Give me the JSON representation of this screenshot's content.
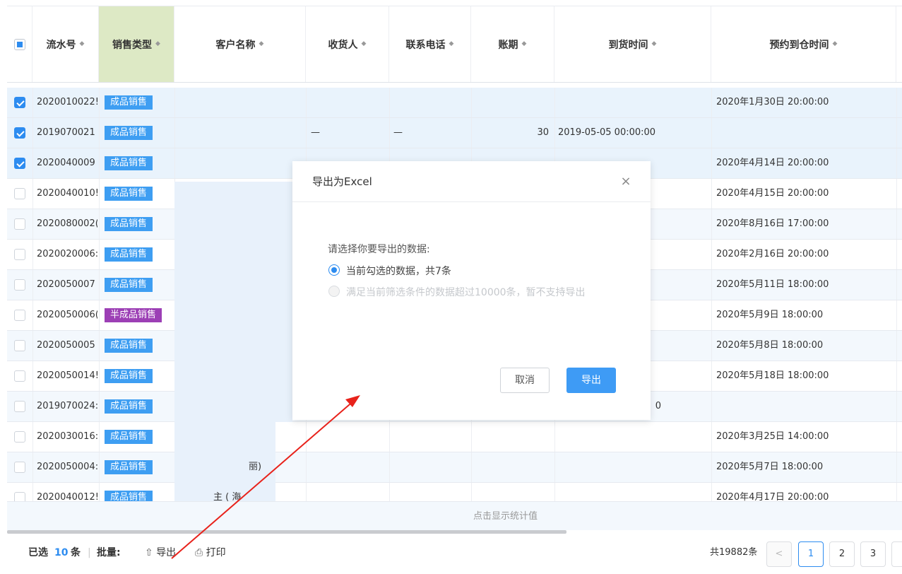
{
  "colors": {
    "tag_finished": "#3e9ef2",
    "tag_semi": "#9c3fb5",
    "primary": "#2d8cf0",
    "arrow": "#e8221b"
  },
  "table": {
    "columns": [
      "流水号",
      "销售类型",
      "客户名称",
      "收货人",
      "联系电话",
      "账期",
      "到货时间",
      "预约到仓时间"
    ],
    "rows": [
      {
        "checked": true,
        "serial": "2020010022!",
        "type": "成品销售",
        "type_kind": "finished",
        "receiver": "",
        "phone": "",
        "term": "",
        "arrival": "",
        "appointment": "2020年1月30日 20:00:00"
      },
      {
        "checked": true,
        "serial": "2019070021",
        "type": "成品销售",
        "type_kind": "finished",
        "receiver": "—",
        "phone": "—",
        "term": "30",
        "arrival": "2019-05-05 00:00:00",
        "appointment": ""
      },
      {
        "checked": true,
        "serial": "2020040009",
        "type": "成品销售",
        "type_kind": "finished",
        "receiver": "",
        "phone": "",
        "term": "",
        "arrival": "",
        "appointment": "2020年4月14日 20:00:00"
      },
      {
        "checked": false,
        "serial": "2020040010!",
        "type": "成品销售",
        "type_kind": "finished",
        "receiver": "",
        "phone": "",
        "term": "",
        "arrival": "",
        "appointment": "2020年4月15日 20:00:00"
      },
      {
        "checked": false,
        "serial": "2020080002(",
        "type": "成品销售",
        "type_kind": "finished",
        "receiver": "",
        "phone": "",
        "term": "",
        "arrival": "",
        "appointment": "2020年8月16日 17:00:00"
      },
      {
        "checked": false,
        "serial": "2020020006:",
        "type": "成品销售",
        "type_kind": "finished",
        "receiver": "",
        "phone": "",
        "term": "",
        "arrival": "",
        "appointment": "2020年2月16日 20:00:00"
      },
      {
        "checked": false,
        "serial": "2020050007",
        "type": "成品销售",
        "type_kind": "finished",
        "receiver": "",
        "phone": "",
        "term": "",
        "arrival": "",
        "appointment": "2020年5月11日 18:00:00"
      },
      {
        "checked": false,
        "serial": "2020050006(",
        "type": "半成品销售",
        "type_kind": "semi",
        "receiver": "",
        "phone": "",
        "term": "",
        "arrival": "",
        "appointment": "2020年5月9日 18:00:00"
      },
      {
        "checked": false,
        "serial": "2020050005",
        "type": "成品销售",
        "type_kind": "finished",
        "receiver": "",
        "phone": "",
        "term": "",
        "arrival": "",
        "appointment": "2020年5月8日 18:00:00"
      },
      {
        "checked": false,
        "serial": "2020050014!",
        "type": "成品销售",
        "type_kind": "finished",
        "receiver": "",
        "phone": "",
        "term": "",
        "arrival": "",
        "appointment": "2020年5月18日 18:00:00"
      },
      {
        "checked": false,
        "serial": "2019070024:",
        "type": "成品销售",
        "type_kind": "finished",
        "receiver": "",
        "phone": "",
        "term": "",
        "arrival": "0",
        "appointment": ""
      },
      {
        "checked": false,
        "serial": "2020030016:",
        "type": "成品销售",
        "type_kind": "finished",
        "receiver": "",
        "phone": "",
        "term": "",
        "arrival": "",
        "appointment": "2020年3月25日 14:00:00"
      },
      {
        "checked": false,
        "serial": "2020050004:",
        "type": "成品销售",
        "type_kind": "finished",
        "receiver": "",
        "phone": "",
        "term": "",
        "arrival": "",
        "appointment": "2020年5月7日 18:00:00"
      },
      {
        "checked": false,
        "serial": "2020040012!",
        "type": "成品销售",
        "type_kind": "finished",
        "receiver": "",
        "phone": "",
        "term": "",
        "arrival": "",
        "appointment": "2020年4月17日 20:00:00"
      }
    ],
    "customer_fragments": [
      {
        "row": 12,
        "text": "丽)"
      },
      {
        "row": 13,
        "text": "主  (  海"
      }
    ],
    "stats_label": "点击显示统计值"
  },
  "footer": {
    "selected_prefix": "已选",
    "selected_count": "10",
    "selected_suffix": "条",
    "batch_label": "批量:",
    "export_label": "导出",
    "print_label": "打印",
    "total_label": "共19882条",
    "prev": "<",
    "pages": [
      "1",
      "2",
      "3"
    ]
  },
  "modal": {
    "title": "导出为Excel",
    "close": "×",
    "prompt": "请选择你要导出的数据:",
    "option_selected": "当前勾选的数据，共7条",
    "option_disabled": "满足当前筛选条件的数据超过10000条，暂不支持导出",
    "cancel": "取消",
    "confirm": "导出"
  }
}
